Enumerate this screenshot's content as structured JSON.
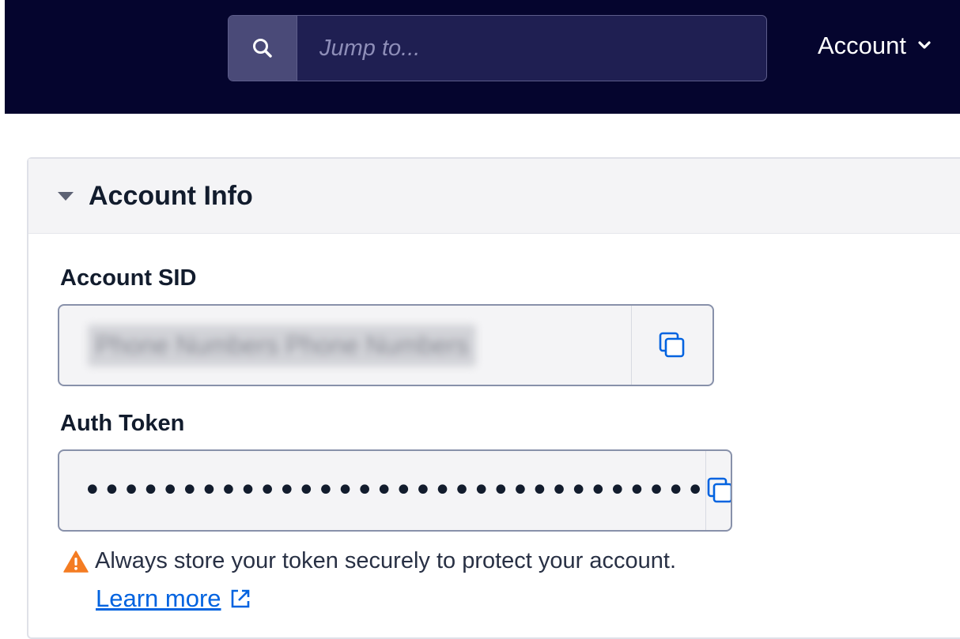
{
  "topbar": {
    "search_placeholder": "Jump to...",
    "account_label": "Account"
  },
  "card": {
    "title": "Account Info",
    "account_sid": {
      "label": "Account SID",
      "value": "Phone Numbers Phone Numbers"
    },
    "auth_token": {
      "label": "Auth Token",
      "value": "••••••••••••••••••••••••••••••••"
    },
    "warning_text": "Always store your token securely to protect your account.",
    "learn_more_label": "Learn more"
  },
  "icons": {
    "search": "search-icon",
    "chevron": "chevron-down-icon",
    "collapse": "triangle-down-icon",
    "copy": "copy-icon",
    "warning": "warning-icon",
    "external": "external-link-icon"
  },
  "colors": {
    "topbar": "#05052e",
    "link": "#0263e0",
    "warning": "#f47c22"
  }
}
